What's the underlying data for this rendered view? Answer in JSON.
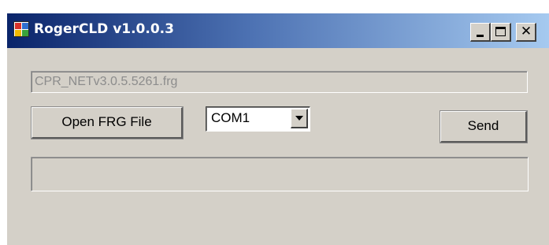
{
  "window": {
    "title": "RogerCLD v1.0.0.3",
    "app_icon": "app-icon",
    "controls": [
      "minimize",
      "maximize",
      "close"
    ],
    "close_glyph": "✕"
  },
  "form": {
    "file_path": "CPR_NETv3.0.5.5261.frg",
    "open_button_label": "Open FRG File",
    "port": {
      "selected": "COM1"
    },
    "send_button_label": "Send",
    "progress": 0
  },
  "colors": {
    "title_gradient_start": "#0a246a",
    "title_gradient_end": "#a6caf0",
    "window_bg": "#d4d0c8"
  }
}
